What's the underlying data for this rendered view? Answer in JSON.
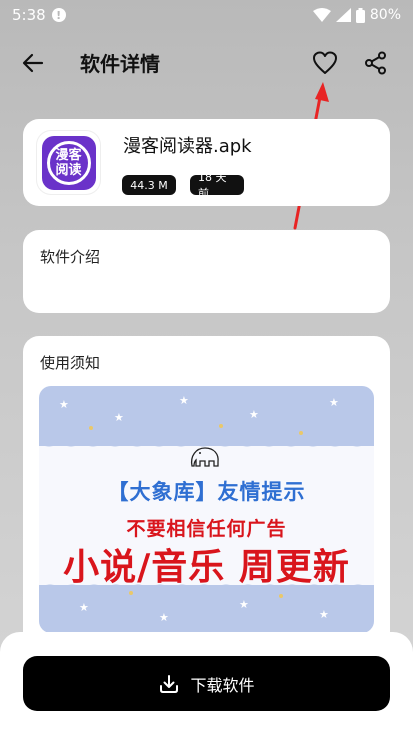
{
  "status_bar": {
    "time": "5:38",
    "battery": "80%",
    "alert_glyph": "!"
  },
  "header": {
    "title": "软件详情",
    "icons": [
      "back-arrow-icon",
      "heart-icon",
      "share-icon"
    ]
  },
  "app": {
    "icon_text_line1": "漫客",
    "icon_text_line2": "阅读",
    "name": "漫客阅读器.apk",
    "size": "44.3 M",
    "updated": "18 天前"
  },
  "sections": {
    "intro_label": "软件介绍",
    "notice_label": "使用须知"
  },
  "banner": {
    "heading": "【大象库】友情提示",
    "subheading": "不要相信任何广告",
    "main": "小说/音乐 周更新"
  },
  "actions": {
    "download_label": "下载软件"
  },
  "colors": {
    "accent": "#000000",
    "app_icon": "#6a32c9",
    "banner_blue": "#2f6fd2",
    "banner_red": "#d9151c"
  }
}
